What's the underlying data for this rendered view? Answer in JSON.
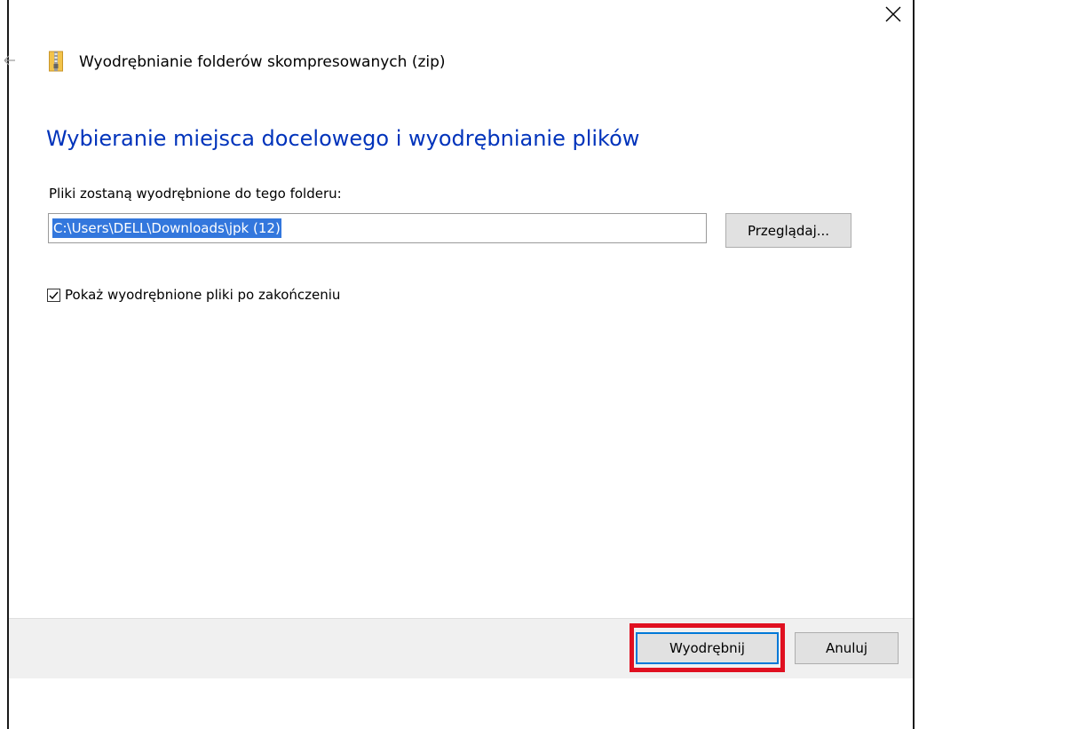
{
  "window": {
    "title": "Wyodrębnianie folderów skompresowanych (zip)"
  },
  "main": {
    "heading": "Wybieranie miejsca docelowego i wyodrębnianie plików",
    "path_label": "Pliki zostaną wyodrębnione do tego folderu:",
    "path_value": "C:\\Users\\DELL\\Downloads\\jpk (12)",
    "browse_label": "Przeglądaj...",
    "show_files_label": "Pokaż wyodrębnione pliki po zakończeniu",
    "show_files_checked": true
  },
  "footer": {
    "extract_label": "Wyodrębnij",
    "cancel_label": "Anuluj"
  },
  "colors": {
    "heading": "#0033bb",
    "selection": "#3377dd",
    "highlight": "#e01020",
    "focus": "#0078d7"
  },
  "icons": {
    "close": "close-icon",
    "back": "back-arrow-icon",
    "zip": "zip-folder-icon",
    "check": "checkmark-icon"
  }
}
